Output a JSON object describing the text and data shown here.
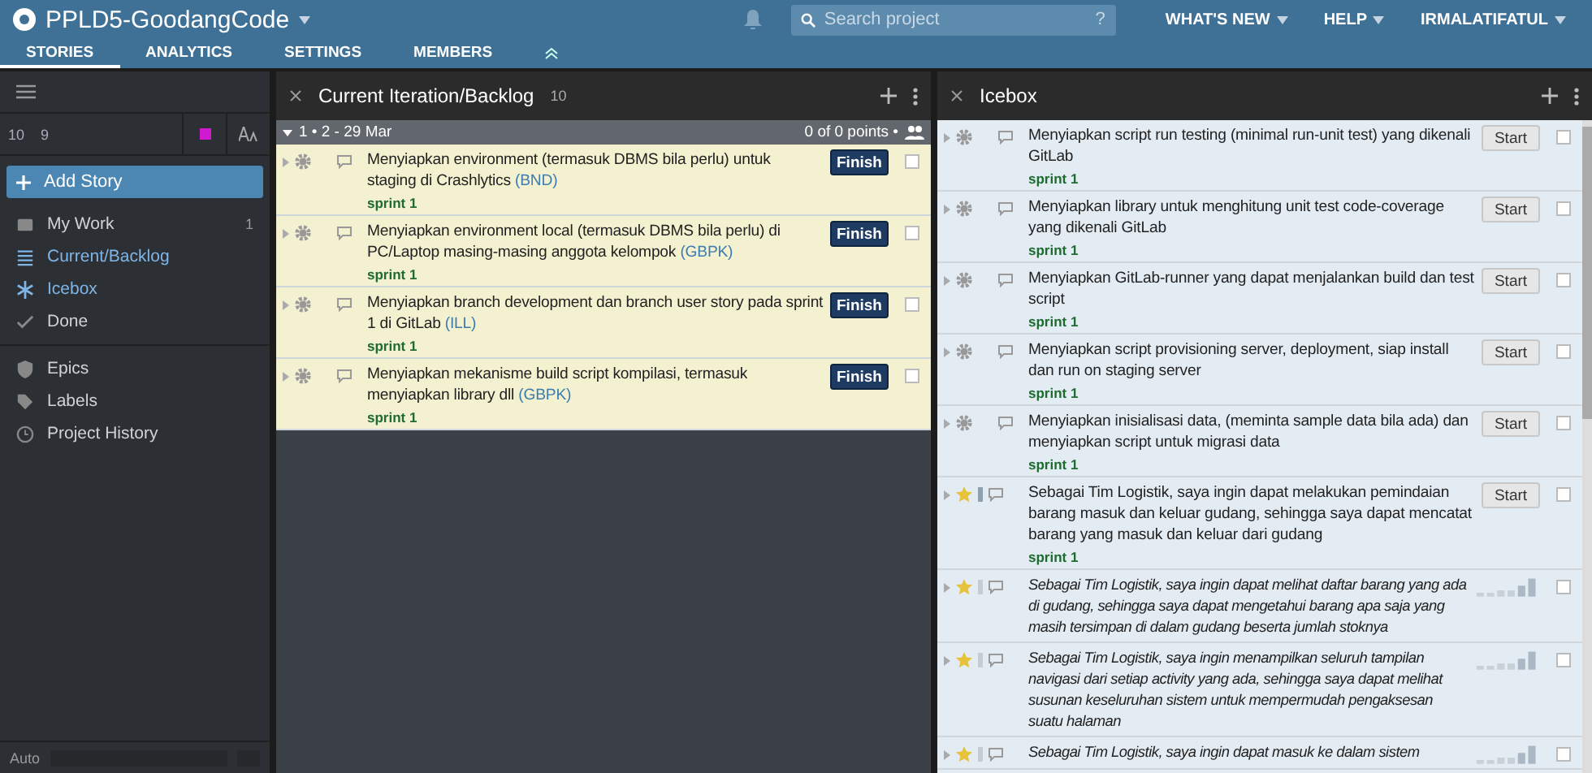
{
  "header": {
    "project": "PPLD5-GoodangCode",
    "search": {
      "placeholder": "Search project",
      "help": "?"
    },
    "menus": [
      "WHAT'S NEW",
      "HELP",
      "IRMALATIFATUL"
    ]
  },
  "tabs": [
    {
      "label": "STORIES",
      "selected": true
    },
    {
      "label": "ANALYTICS",
      "selected": false
    },
    {
      "label": "SETTINGS",
      "selected": false
    },
    {
      "label": "MEMBERS",
      "selected": false
    }
  ],
  "sidebar": {
    "velocity": "10",
    "members": "9",
    "add_story": "Add Story",
    "items": [
      {
        "label": "My Work",
        "count": "1",
        "kind": "inbox",
        "selected": false
      },
      {
        "label": "Current/Backlog",
        "kind": "list",
        "selected": true
      },
      {
        "label": "Icebox",
        "kind": "snow",
        "selected": true
      },
      {
        "label": "Done",
        "kind": "check",
        "selected": false
      },
      {
        "label": "Epics",
        "kind": "shield",
        "selected": false
      },
      {
        "label": "Labels",
        "kind": "tag",
        "selected": false
      },
      {
        "label": "Project History",
        "kind": "clock",
        "selected": false
      }
    ],
    "footer": "Auto"
  },
  "backlog": {
    "title": "Current Iteration/Backlog",
    "velocity": "10",
    "iteration": {
      "label": "1 • 2 - 29 Mar",
      "points": "0 of 0 points •"
    },
    "stories": [
      {
        "kind": "chore",
        "title": "Menyiapkan environment (termasuk DBMS bila perlu) untuk staging di Crashlytics",
        "owner": "(BND)",
        "label": "sprint 1",
        "button": "Finish",
        "unestimated": false,
        "checked": false
      },
      {
        "kind": "chore",
        "title": "Menyiapkan environment local (termasuk DBMS bila perlu) di PC/Laptop masing-masing anggota kelompok",
        "owner": "(GBPK)",
        "label": "sprint 1",
        "button": "Finish",
        "unestimated": false,
        "checked": false
      },
      {
        "kind": "chore",
        "title": "Menyiapkan branch development dan branch user story pada sprint 1 di GitLab",
        "owner": "(ILL)",
        "label": "sprint 1",
        "button": "Finish",
        "unestimated": false,
        "checked": false
      },
      {
        "kind": "chore",
        "title": "Menyiapkan mekanisme build script kompilasi, termasuk menyiapkan library dll",
        "owner": "(GBPK)",
        "label": "sprint 1",
        "button": "Finish",
        "unestimated": false,
        "checked": false
      }
    ]
  },
  "icebox": {
    "title": "Icebox",
    "stories": [
      {
        "kind": "chore",
        "title": "Menyiapkan script run testing (minimal run-unit test) yang dikenali GitLab",
        "label": "sprint 1",
        "button": "Start",
        "unestimated": false,
        "checked": false
      },
      {
        "kind": "chore",
        "title": "Menyiapkan library untuk menghitung unit test code-coverage yang dikenali GitLab",
        "label": "sprint 1",
        "button": "Start",
        "unestimated": false,
        "checked": false
      },
      {
        "kind": "chore",
        "title": "Menyiapkan GitLab-runner yang dapat menjalankan build dan test script",
        "label": "sprint 1",
        "button": "Start",
        "unestimated": false,
        "checked": false
      },
      {
        "kind": "chore",
        "title": "Menyiapkan script provisioning server, deployment, siap install dan run on staging server",
        "label": "sprint 1",
        "button": "Start",
        "unestimated": false,
        "checked": false
      },
      {
        "kind": "chore",
        "title": "Menyiapkan inisialisasi data, (meminta sample data bila ada) dan menyiapkan script untuk migrasi data",
        "label": "sprint 1",
        "button": "Start",
        "unestimated": false,
        "checked": false
      },
      {
        "kind": "feature",
        "title": "Sebagai Tim Logistik, saya ingin dapat melakukan pemindaian barang masuk dan keluar gudang, sehingga saya dapat mencatat barang yang masuk dan keluar dari gudang",
        "label": "sprint 1",
        "button": "Start",
        "unestimated": false,
        "checked": false
      },
      {
        "kind": "feature",
        "title": "Sebagai Tim Logistik, saya ingin dapat melihat daftar barang yang ada di gudang, sehingga saya dapat mengetahui barang apa saja yang masih tersimpan di dalam gudang beserta jumlah stoknya",
        "unestimated": true,
        "checked": false
      },
      {
        "kind": "feature",
        "title": "Sebagai Tim Logistik, saya ingin menampilkan seluruh tampilan navigasi dari setiap activity yang ada, sehingga saya dapat melihat susunan keseluruhan sistem untuk mempermudah pengaksesan suatu halaman",
        "unestimated": true,
        "checked": false
      },
      {
        "kind": "feature",
        "title": "Sebagai Tim Logistik, saya ingin dapat masuk ke dalam sistem",
        "unestimated": true,
        "checked": false
      }
    ]
  }
}
